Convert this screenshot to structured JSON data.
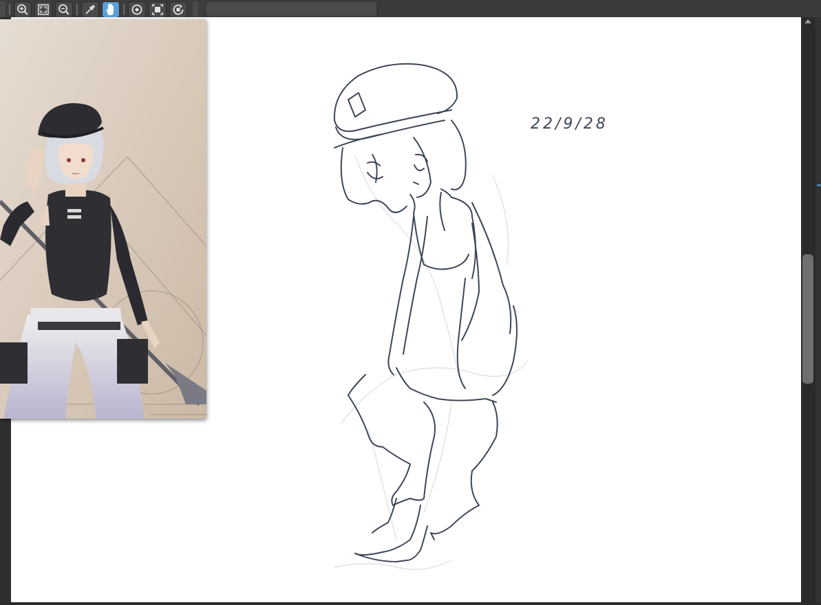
{
  "toolbar": {
    "buttons": [
      {
        "name": "zoom-in",
        "icon": "zoom-in-icon"
      },
      {
        "name": "fit-to-window",
        "icon": "fit-screen-icon"
      },
      {
        "name": "zoom-out",
        "icon": "zoom-out-icon"
      },
      {
        "name": "eyedropper",
        "icon": "eyedropper-icon"
      },
      {
        "name": "hand",
        "icon": "hand-icon",
        "active": true
      },
      {
        "name": "rotate",
        "icon": "rotate-icon"
      },
      {
        "name": "flip",
        "icon": "flip-icon"
      },
      {
        "name": "reset-rotation",
        "icon": "reset-rotation-icon"
      }
    ],
    "active_color": "#5a9fd6"
  },
  "canvas": {
    "annotation_text": "22/9/28",
    "line_color": "#3d4656",
    "background": "#ffffff"
  },
  "reference_panel": {
    "visible": true,
    "image": "reference-illustration"
  },
  "scrollbar": {
    "position_fraction": 0.45
  }
}
